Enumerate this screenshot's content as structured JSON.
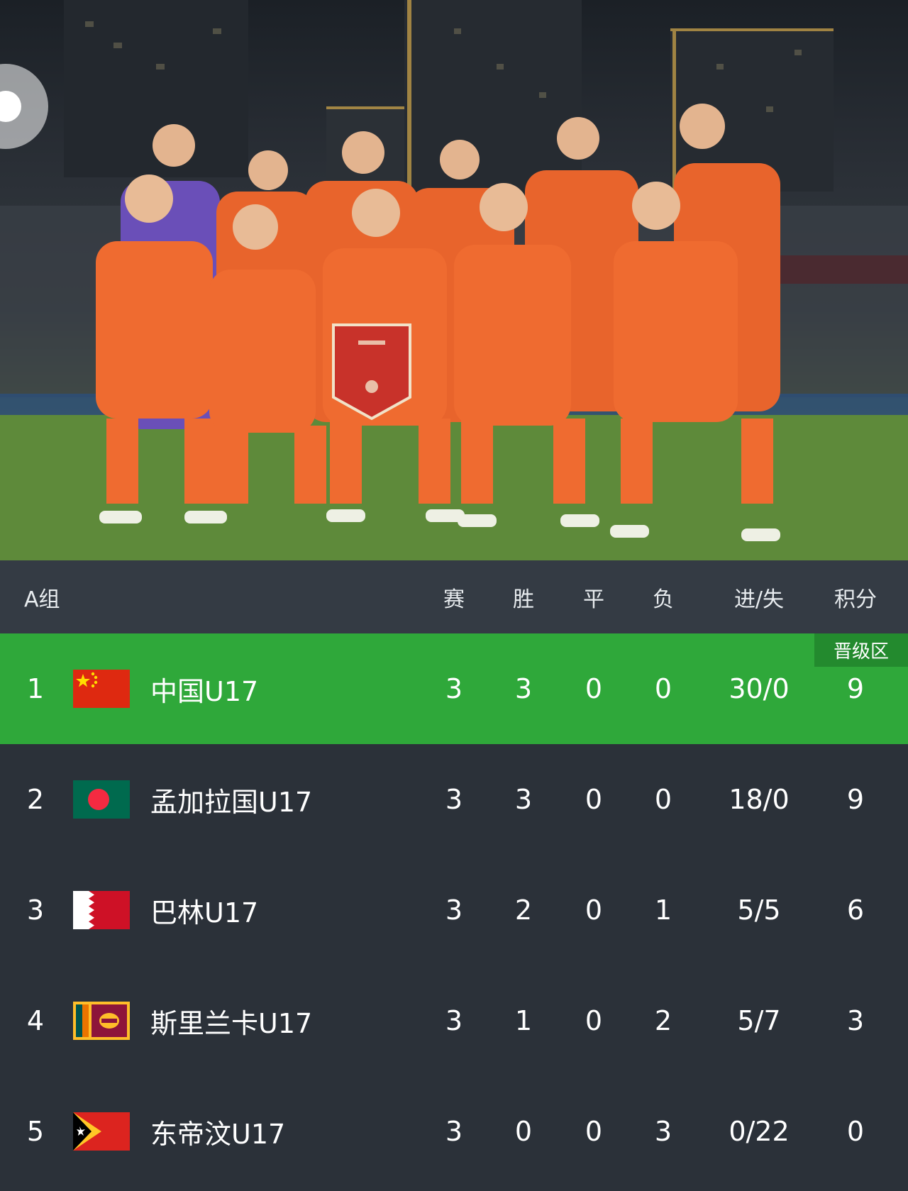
{
  "header": {
    "group": "A组",
    "cols": [
      "赛",
      "胜",
      "平",
      "负",
      "进/失",
      "积分"
    ]
  },
  "badge": "晋级区",
  "rows": [
    {
      "rank": "1",
      "team": "中国U17",
      "flag": "china-flag-icon",
      "p": "3",
      "w": "3",
      "d": "0",
      "l": "0",
      "gf": "30/0",
      "pts": "9"
    },
    {
      "rank": "2",
      "team": "孟加拉国U17",
      "flag": "bangladesh-flag-icon",
      "p": "3",
      "w": "3",
      "d": "0",
      "l": "0",
      "gf": "18/0",
      "pts": "9"
    },
    {
      "rank": "3",
      "team": "巴林U17",
      "flag": "bahrain-flag-icon",
      "p": "3",
      "w": "2",
      "d": "0",
      "l": "1",
      "gf": "5/5",
      "pts": "6"
    },
    {
      "rank": "4",
      "team": "斯里兰卡U17",
      "flag": "sri-lanka-flag-icon",
      "p": "3",
      "w": "1",
      "d": "0",
      "l": "2",
      "gf": "5/7",
      "pts": "3"
    },
    {
      "rank": "5",
      "team": "东帝汶U17",
      "flag": "timor-leste-flag-icon",
      "p": "3",
      "w": "0",
      "d": "0",
      "l": "3",
      "gf": "0/22",
      "pts": "0"
    }
  ],
  "colors": {
    "promotion": "#2fa83a",
    "badge": "#238a2e",
    "header_bg": "#343b44",
    "table_bg": "#2b3139",
    "jersey": "#e8642c"
  }
}
